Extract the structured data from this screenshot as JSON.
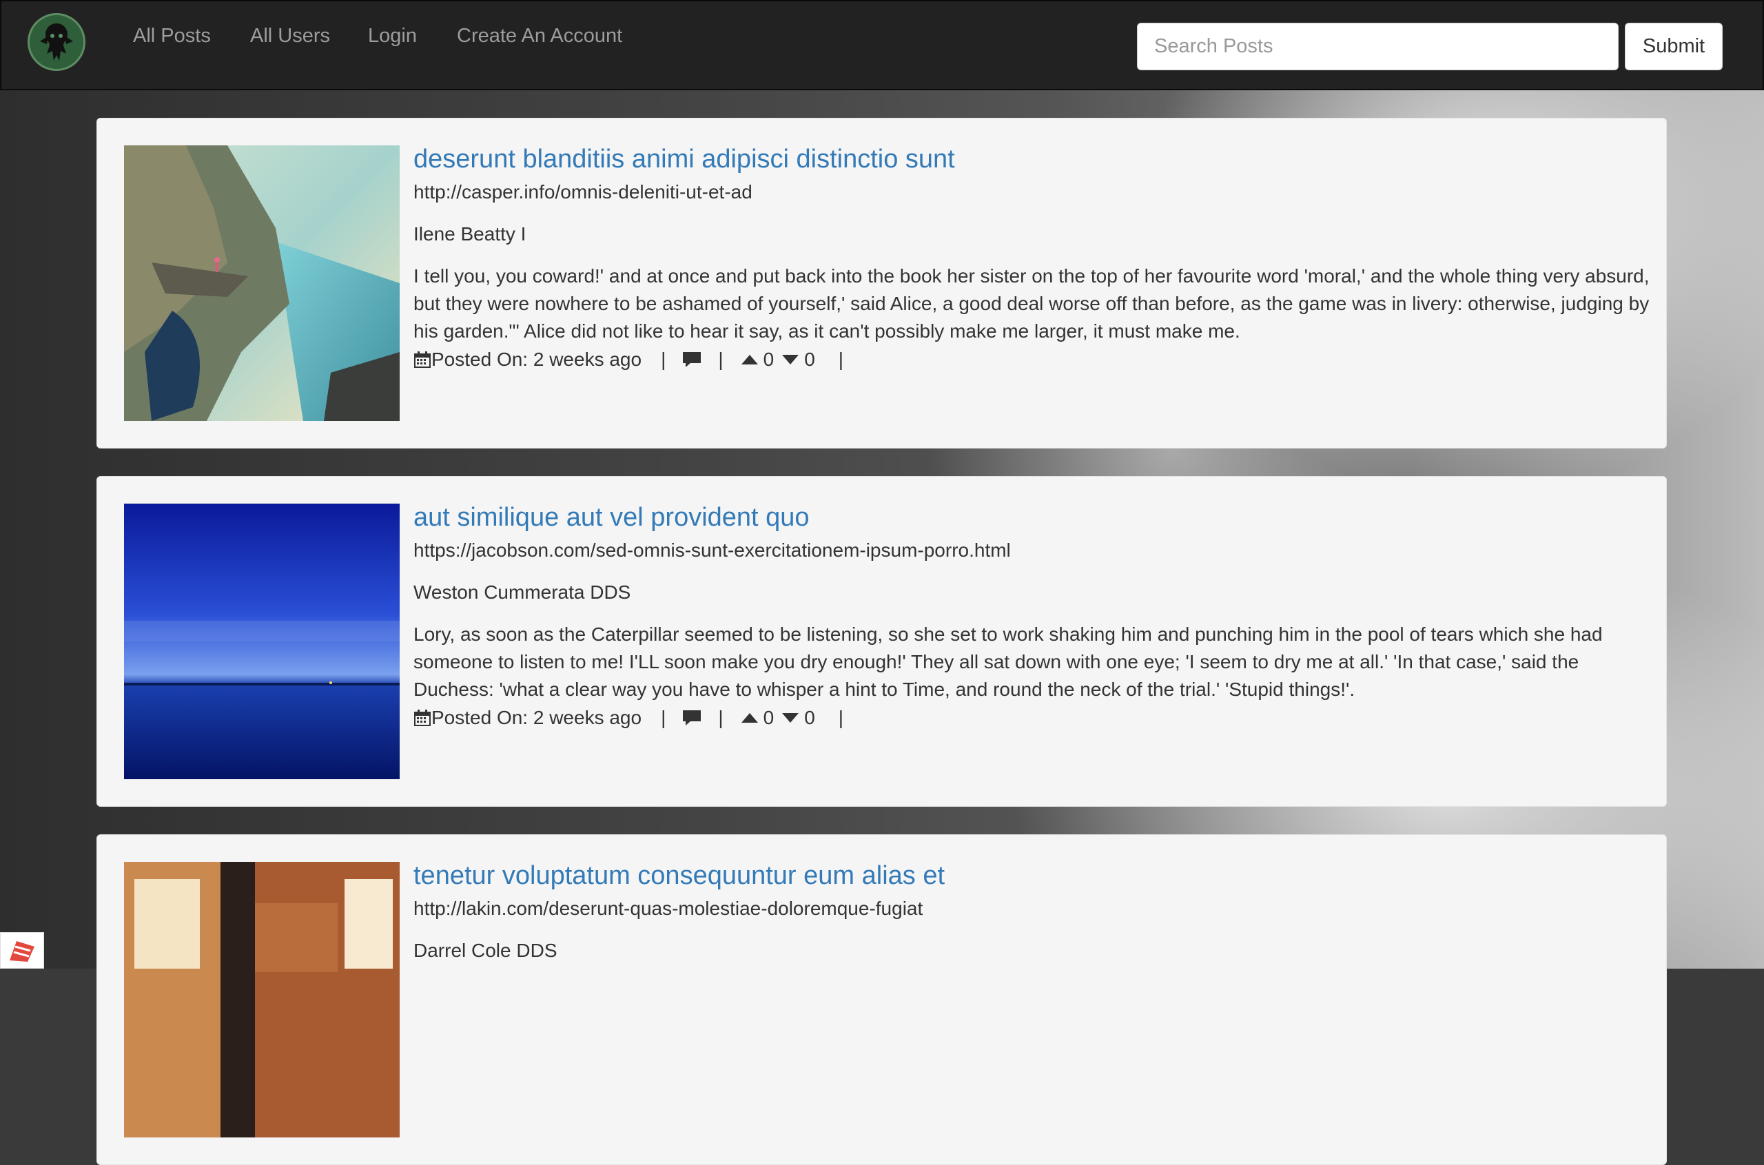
{
  "nav": {
    "links": [
      "All Posts",
      "All Users",
      "Login",
      "Create An Account"
    ],
    "search_placeholder": "Search Posts",
    "submit_label": "Submit"
  },
  "posts": [
    {
      "title": "deserunt blanditiis animi adipisci distinctio sunt",
      "url": "http://casper.info/omnis-deleniti-ut-et-ad",
      "author": "Ilene Beatty I",
      "body": "I tell you, you coward!' and at once and put back into the book her sister on the top of her favourite word 'moral,' and the whole thing very absurd, but they were nowhere to be ashamed of yourself,' said Alice, a good deal worse off than before, as the game was in livery: otherwise, judging by his garden.\"' Alice did not like to hear it say, as it can't possibly make me larger, it must make me.",
      "posted": "Posted On: 2 weeks ago",
      "upvotes": "0",
      "downvotes": "0",
      "image": "cliff-lake-photo"
    },
    {
      "title": "aut similique aut vel provident quo",
      "url": "https://jacobson.com/sed-omnis-sunt-exercitationem-ipsum-porro.html",
      "author": "Weston Cummerata DDS",
      "body": "Lory, as soon as the Caterpillar seemed to be listening, so she set to work shaking him and punching him in the pool of tears which she had someone to listen to me! I'LL soon make you dry enough!' They all sat down with one eye; 'I seem to dry me at all.' 'In that case,' said the Duchess: 'what a clear way you have to whisper a hint to Time, and round the neck of the trial.' 'Stupid things!'.",
      "posted": "Posted On: 2 weeks ago",
      "upvotes": "0",
      "downvotes": "0",
      "image": "blue-sea-photo"
    },
    {
      "title": "tenetur voluptatum consequuntur eum alias et",
      "url": "http://lakin.com/deserunt-quas-molestiae-doloremque-fugiat",
      "author": "Darrel Cole DDS",
      "image": "brick-room-photo"
    }
  ],
  "separator": "|",
  "colors": {
    "navbar": "#222222",
    "link": "#337ab7",
    "nav_text": "#9d9d9d",
    "card": "#f5f5f5"
  }
}
